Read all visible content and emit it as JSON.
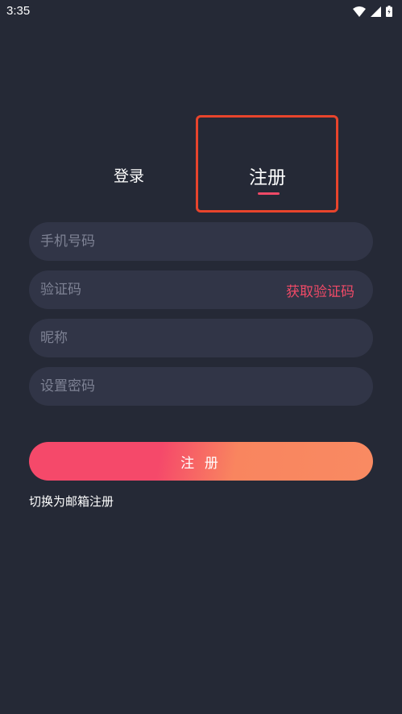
{
  "status_bar": {
    "time": "3:35",
    "icons": [
      "wifi-icon",
      "signal-icon",
      "battery-icon"
    ]
  },
  "tabs": {
    "login": "登录",
    "register": "注册",
    "active": "register"
  },
  "form": {
    "phone_placeholder": "手机号码",
    "code_placeholder": "验证码",
    "get_code_label": "获取验证码",
    "nickname_placeholder": "昵称",
    "password_placeholder": "设置密码",
    "submit_label": "注 册",
    "switch_label": "切换为邮箱注册"
  },
  "colors": {
    "background": "#252936",
    "field": "#313547",
    "accent": "#f04a67",
    "gradient_end": "#f98a62",
    "highlight": "#e8442c"
  }
}
